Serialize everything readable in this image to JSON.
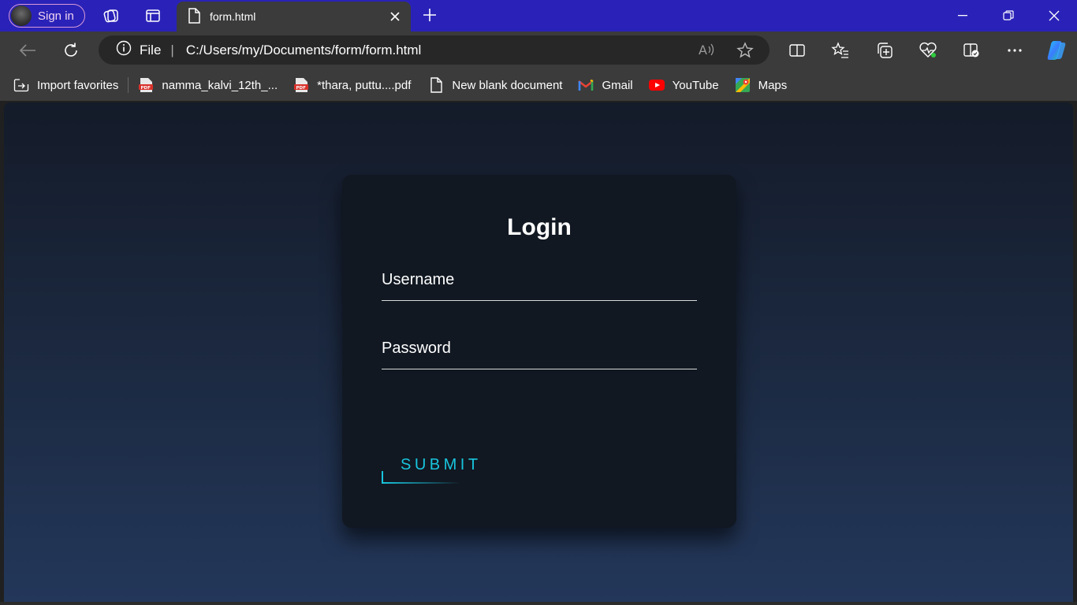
{
  "browser": {
    "profile_label": "Sign in",
    "tab_title": "form.html",
    "address_scheme": "File",
    "address_url": "C:/Users/my/Documents/form/form.html",
    "accent_color": "#2a22b8"
  },
  "bookmarks": [
    {
      "label": "Import favorites",
      "icon": "import-icon"
    },
    {
      "label": "namma_kalvi_12th_...",
      "icon": "pdf-icon"
    },
    {
      "label": "*thara, puttu....pdf",
      "icon": "pdf-icon"
    },
    {
      "label": "New blank document",
      "icon": "document-icon"
    },
    {
      "label": "Gmail",
      "icon": "gmail-icon"
    },
    {
      "label": "YouTube",
      "icon": "youtube-icon"
    },
    {
      "label": "Maps",
      "icon": "maps-icon"
    }
  ],
  "login": {
    "title": "Login",
    "username_label": "Username",
    "password_label": "Password",
    "submit_label": "SUBMIT",
    "accent_color": "#18c5dd"
  }
}
